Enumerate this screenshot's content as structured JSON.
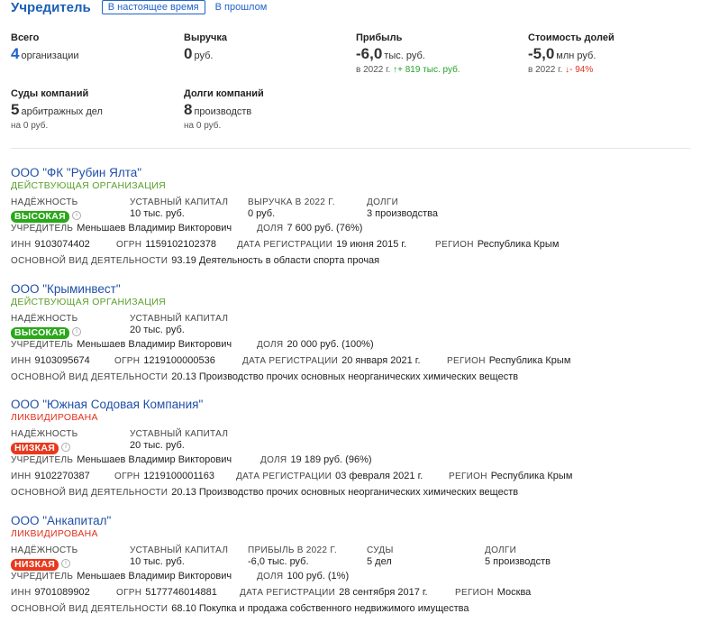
{
  "header": {
    "title": "Учредитель",
    "tabs": [
      {
        "label": "В настоящее время",
        "active": true
      },
      {
        "label": "В прошлом",
        "active": false
      }
    ]
  },
  "stats": {
    "total": {
      "label": "Всего",
      "value": "4",
      "unit": "организации"
    },
    "revenue": {
      "label": "Выручка",
      "value": "0",
      "unit": "руб."
    },
    "profit": {
      "label": "Прибыль",
      "value": "-6,0",
      "unit": "тыс. руб.",
      "year": "в 2022 г.",
      "change_arrow": "↑",
      "change": "+ 819 тыс. руб."
    },
    "shares": {
      "label": "Стоимость долей",
      "value": "-5,0",
      "unit": "млн руб.",
      "year": "в 2022 г.",
      "change_arrow": "↓",
      "change": "- 94%"
    },
    "courts": {
      "label": "Суды компаний",
      "value": "5",
      "unit": "арбитражных дел",
      "sub": "на 0 руб."
    },
    "debts": {
      "label": "Долги компаний",
      "value": "8",
      "unit": "производств",
      "sub": "на 0 руб."
    }
  },
  "labels": {
    "reliability": "НАДЁЖНОСТЬ",
    "capital": "УСТАВНЫЙ КАПИТАЛ",
    "founder": "УЧРЕДИТЕЛЬ",
    "share": "ДОЛЯ",
    "inn": "ИНН",
    "ogrn": "ОГРН",
    "reg_date": "ДАТА РЕГИСТРАЦИИ",
    "region": "РЕГИОН",
    "activity": "ОСНОВНОЙ ВИД ДЕЯТЕЛЬНОСТИ"
  },
  "companies": [
    {
      "name": "ООО \"ФК \"Рубин Ялта\"",
      "status": "ДЕЙСТВУЮЩАЯ ОРГАНИЗАЦИЯ",
      "reliability": "ВЫСОКАЯ",
      "capital": "10 тыс. руб.",
      "extra1_label": "ВЫРУЧКА В 2022 Г.",
      "extra1_value": "0 руб.",
      "extra2_label": "ДОЛГИ",
      "extra2_value": "3 производства",
      "founder": "Меньшаев Владимир Викторович",
      "share": "7 600 руб. (76%)",
      "inn": "9103074402",
      "ogrn": "1159102102378",
      "reg_date": "19 июня 2015 г.",
      "region": "Республика Крым",
      "activity": "93.19 Деятельность в области спорта прочая"
    },
    {
      "name": "ООО \"Крыминвест\"",
      "status": "ДЕЙСТВУЮЩАЯ ОРГАНИЗАЦИЯ",
      "reliability": "ВЫСОКАЯ",
      "capital": "20 тыс. руб.",
      "founder": "Меньшаев Владимир Викторович",
      "share": "20 000 руб. (100%)",
      "inn": "9103095674",
      "ogrn": "1219100000536",
      "reg_date": "20 января 2021 г.",
      "region": "Республика Крым",
      "activity": "20.13 Производство прочих основных неорганических химических веществ"
    },
    {
      "name": "ООО \"Южная Содовая Компания\"",
      "status": "ЛИКВИДИРОВАНА",
      "reliability": "НИЗКАЯ",
      "capital": "20 тыс. руб.",
      "founder": "Меньшаев Владимир Викторович",
      "share": "19 189 руб. (96%)",
      "inn": "9102270387",
      "ogrn": "1219100001163",
      "reg_date": "03 февраля 2021 г.",
      "region": "Республика Крым",
      "activity": "20.13 Производство прочих основных неорганических химических веществ"
    },
    {
      "name": "ООО \"Анкапитал\"",
      "status": "ЛИКВИДИРОВАНА",
      "reliability": "НИЗКАЯ",
      "capital": "10 тыс. руб.",
      "extra1_label": "ПРИБЫЛЬ В 2022 Г.",
      "extra1_value": "-6,0 тыс. руб.",
      "extra2_label": "СУДЫ",
      "extra2_value": "5 дел",
      "extra3_label": "ДОЛГИ",
      "extra3_value": "5 производств",
      "founder": "Меньшаев Владимир Викторович",
      "share": "100 руб. (1%)",
      "inn": "9701089902",
      "ogrn": "5177746014881",
      "reg_date": "28 сентября 2017 г.",
      "region": "Москва",
      "activity": "68.10 Покупка и продажа собственного недвижимого имущества"
    }
  ]
}
